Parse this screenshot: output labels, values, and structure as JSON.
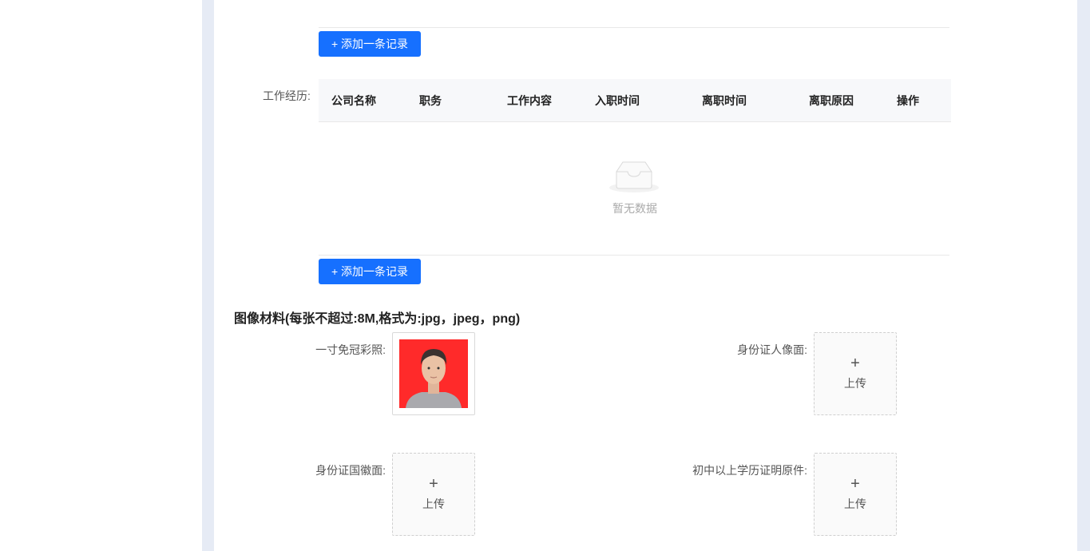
{
  "buttons": {
    "add_record_label": "+ 添加一条记录"
  },
  "work_experience": {
    "label": "工作经历:",
    "columns": [
      "公司名称",
      "职务",
      "工作内容",
      "入职时间",
      "离职时间",
      "离职原因",
      "操作"
    ],
    "empty_text": "暂无数据"
  },
  "images": {
    "title": "图像材料(每张不超过:8M,格式为:jpg，jpeg，png)",
    "upload_text": "上传",
    "items": [
      {
        "label": "一寸免冠彩照:"
      },
      {
        "label": "身份证人像面:"
      },
      {
        "label": "身份证国徽面:"
      },
      {
        "label": "初中以上学历证明原件:"
      }
    ]
  },
  "colors": {
    "primary": "#1670ff",
    "photo_bg": "#ff2a2a",
    "side_strip": "#e6ebf5"
  }
}
